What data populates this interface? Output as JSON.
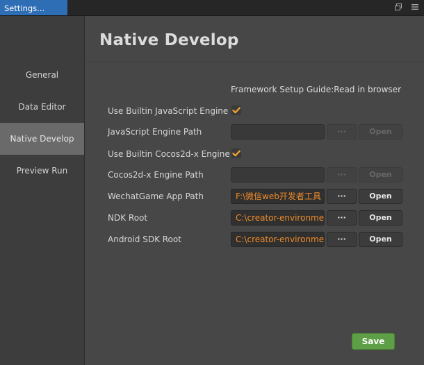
{
  "window": {
    "tab_title": "Settings..."
  },
  "titlebar_icons": {
    "restore": "restore-icon",
    "menu": "menu-icon"
  },
  "sidebar": {
    "items": [
      {
        "label": "General",
        "active": false
      },
      {
        "label": "Data Editor",
        "active": false
      },
      {
        "label": "Native Develop",
        "active": true
      },
      {
        "label": "Preview Run",
        "active": false
      }
    ]
  },
  "main": {
    "title": "Native Develop",
    "guide_text": "Framework Setup Guide:Read in browser",
    "rows": {
      "builtin_js": {
        "label": "Use Builtin JavaScript Engine",
        "checked": true
      },
      "js_engine_path": {
        "label": "JavaScript Engine Path",
        "value": "",
        "dots": "···",
        "open": "Open",
        "enabled": false
      },
      "builtin_cocos": {
        "label": "Use Builtin Cocos2d-x Engine",
        "checked": true
      },
      "cocos_engine_path": {
        "label": "Cocos2d-x Engine Path",
        "value": "",
        "dots": "···",
        "open": "Open",
        "enabled": false
      },
      "wechat_path": {
        "label": "WechatGame App Path",
        "value": "F:\\微信web开发者工具",
        "dots": "···",
        "open": "Open",
        "enabled": true
      },
      "ndk_root": {
        "label": "NDK Root",
        "value": "C:\\creator-environment",
        "dots": "···",
        "open": "Open",
        "enabled": true
      },
      "android_sdk": {
        "label": "Android SDK Root",
        "value": "C:\\creator-environment",
        "dots": "···",
        "open": "Open",
        "enabled": true
      }
    },
    "save_label": "Save"
  },
  "colors": {
    "accent_tab": "#2e6eb5",
    "path_text": "#f08c2a",
    "checkmark": "#f0a030",
    "save_button": "#5e9e46",
    "active_nav": "#6a6a6a"
  }
}
